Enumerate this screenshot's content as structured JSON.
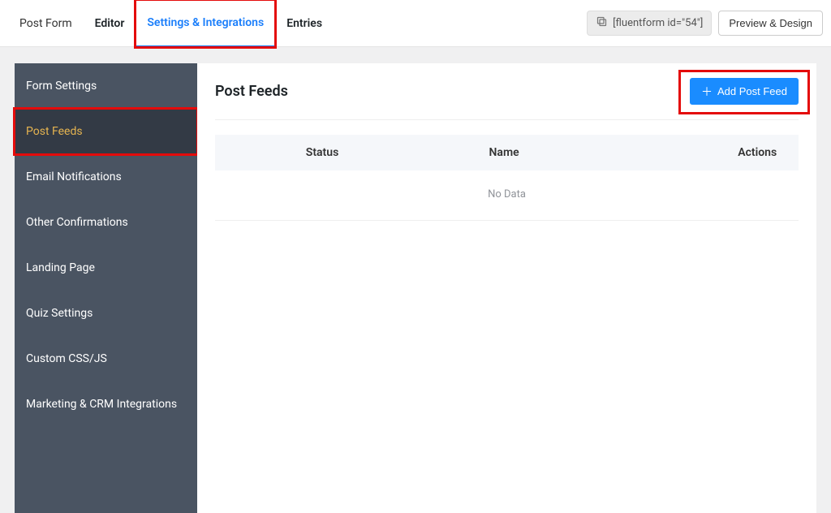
{
  "topbar": {
    "tabs": [
      {
        "label": "Post Form"
      },
      {
        "label": "Editor"
      },
      {
        "label": "Settings & Integrations"
      },
      {
        "label": "Entries"
      }
    ],
    "shortcode": "[fluentform id=\"54\"]",
    "preview_label": "Preview & Design"
  },
  "sidebar": {
    "items": [
      {
        "label": "Form Settings"
      },
      {
        "label": "Post Feeds"
      },
      {
        "label": "Email Notifications"
      },
      {
        "label": "Other Confirmations"
      },
      {
        "label": "Landing Page"
      },
      {
        "label": "Quiz Settings"
      },
      {
        "label": "Custom CSS/JS"
      },
      {
        "label": "Marketing & CRM Integrations"
      }
    ]
  },
  "main": {
    "title": "Post Feeds",
    "add_button": "Add Post Feed",
    "columns": {
      "status": "Status",
      "name": "Name",
      "actions": "Actions"
    },
    "empty_text": "No Data"
  }
}
